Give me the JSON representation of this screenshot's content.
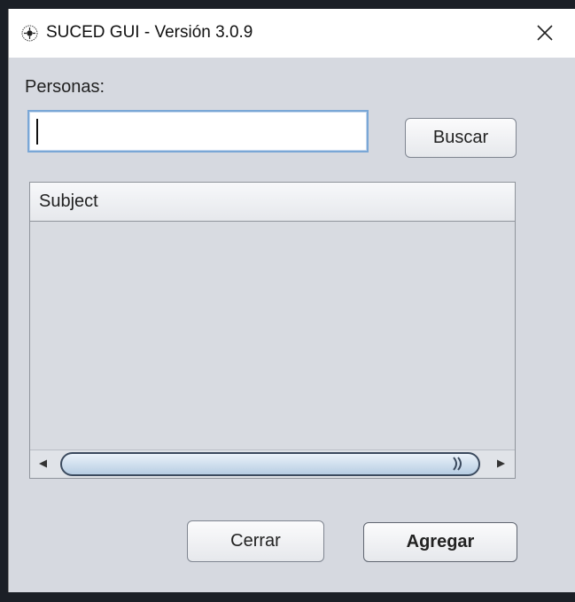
{
  "window": {
    "title": "SUCED GUI - Versión 3.0.9",
    "icon": "app-emblem-icon",
    "close_icon": "close-icon"
  },
  "form": {
    "personas_label": "Personas:",
    "search_value": "",
    "search_placeholder": "",
    "buscar_label": "Buscar"
  },
  "table": {
    "columns": [
      "Subject"
    ],
    "rows": []
  },
  "scrollbar": {
    "left_icon": "arrow-left-icon",
    "right_icon": "arrow-right-icon"
  },
  "footer": {
    "cerrar_label": "Cerrar",
    "agregar_label": "Agregar"
  }
}
